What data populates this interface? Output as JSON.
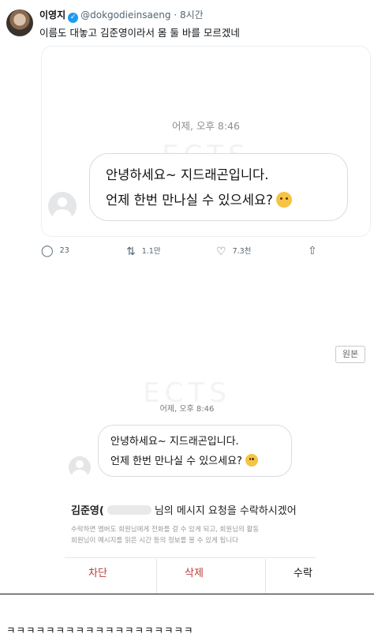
{
  "tweet": {
    "name": "이영지",
    "handle": "@dokgodieinsaeng",
    "time": "· 8시간",
    "text": "이름도 대놓고 김준영이라서 몸 둘 바를 모르겠네",
    "card": {
      "timestamp": "어제, 오후 8:46",
      "watermark": "ECTS",
      "message_line1": "안녕하세요~ 지드래곤입니다.",
      "message_line2": "언제 한번 만나실 수 있으세요?"
    },
    "actions": {
      "replies": "23",
      "retweets": "1.1만",
      "likes": "7.3천"
    }
  },
  "screenshot2": {
    "original_badge": "원본",
    "watermark": "ECTS",
    "timestamp": "어제, 오후 8:46",
    "message_line1": "안녕하세요~ 지드래곤입니다.",
    "message_line2": "언제 한번 만나실 수 있으세요?",
    "sheet": {
      "title_name": "김준영(",
      "title_rest": "님의 메시지 요청을 수락하시겠어",
      "desc_line1": "수락하면 멤버도 회원님에게 전화를 걸 수 있게 되고, 회원님의 활동",
      "desc_line2": "회원님이 메시지를 읽은 시간 등의 정보를 볼 수 있게 됩니다",
      "block": "차단",
      "delete": "삭제",
      "accept": "수락"
    }
  },
  "comment": "ㅋㅋㅋㅋㅋㅋㅋㅋㅋㅋㅋㅋㅋㅋㅋㅋㅋㅋㅋ",
  "icons": {
    "verified": "verified-badge-icon",
    "reply": "reply-icon",
    "retweet": "retweet-icon",
    "like": "heart-icon",
    "share": "share-icon",
    "emoji": "shushing-face-emoji"
  },
  "colors": {
    "verified": "#1d9bf0",
    "block_delete": "#b83a3a",
    "muted_text": "#536471"
  }
}
